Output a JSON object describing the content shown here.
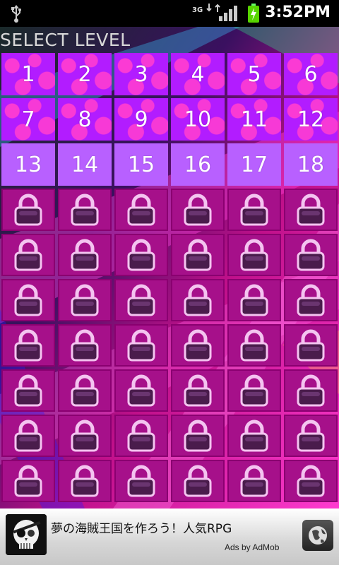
{
  "status_bar": {
    "network": "3G",
    "time": "3:52PM",
    "icons": [
      "usb-icon",
      "network-3g-icon",
      "signal-icon",
      "battery-charging-icon"
    ]
  },
  "screen": {
    "title": "SELECT LEVEL"
  },
  "levels": {
    "unlocked": [
      "1",
      "2",
      "3",
      "4",
      "5",
      "6",
      "7",
      "8",
      "9",
      "10",
      "11",
      "12",
      "13",
      "14",
      "15",
      "16",
      "17",
      "18"
    ],
    "locked_count": 42,
    "locked_icon": "padlock-icon"
  },
  "colors": {
    "star_tile": "#b21cff",
    "unlocked_plain_tile": "#b860ff",
    "locked_tile": "#a6108a",
    "star": "#ff3cd2"
  },
  "ad": {
    "headline": "夢の海賊王国を作ろう！人気RPG",
    "attribution": "Ads by AdMob",
    "icons": [
      "pirate-skull-icon",
      "globe-icon"
    ]
  }
}
